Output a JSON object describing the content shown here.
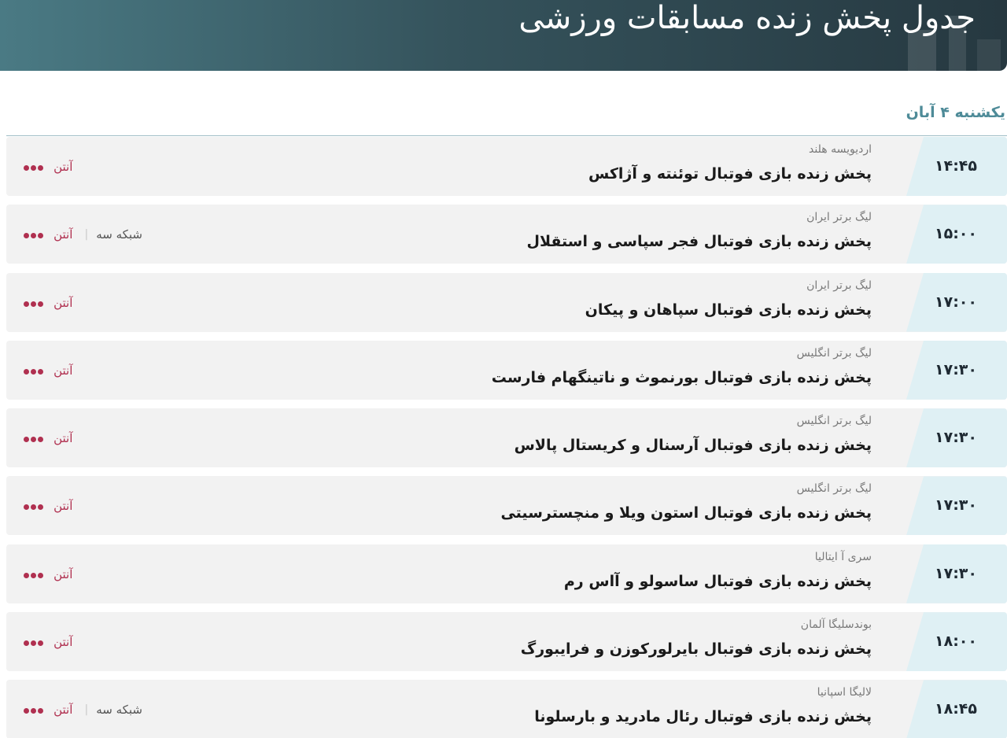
{
  "header": {
    "title": "جدول پخش زنده مسابقات ورزشی"
  },
  "day": {
    "label": "یکشنبه ۴ آبان"
  },
  "matches": [
    {
      "time": "۱۴:۴۵",
      "league": "اردیویسه هلند",
      "title": "پخش زنده بازی فوتبال توئنته و آژاکس",
      "antenna": "آنتن",
      "network": ""
    },
    {
      "time": "۱۵:۰۰",
      "league": "لیگ برتر ایران",
      "title": "پخش زنده بازی فوتبال فجر سپاسی و استقلال",
      "antenna": "آنتن",
      "network": "شبکه سه"
    },
    {
      "time": "۱۷:۰۰",
      "league": "لیگ برتر ایران",
      "title": "پخش زنده بازی فوتبال سپاهان و پیکان",
      "antenna": "آنتن",
      "network": ""
    },
    {
      "time": "۱۷:۳۰",
      "league": "لیگ برتر انگلیس",
      "title": "پخش زنده بازی فوتبال بورنموث و ناتینگهام فارست",
      "antenna": "آنتن",
      "network": ""
    },
    {
      "time": "۱۷:۳۰",
      "league": "لیگ برتر انگلیس",
      "title": "پخش زنده بازی فوتبال آرسنال و کریستال پالاس",
      "antenna": "آنتن",
      "network": ""
    },
    {
      "time": "۱۷:۳۰",
      "league": "لیگ برتر انگلیس",
      "title": "پخش زنده بازی فوتبال استون ویلا و منچسترسیتی",
      "antenna": "آنتن",
      "network": ""
    },
    {
      "time": "۱۷:۳۰",
      "league": "سری آ ایتالیا",
      "title": "پخش زنده بازی فوتبال ساسولو و آاس رم",
      "antenna": "آنتن",
      "network": ""
    },
    {
      "time": "۱۸:۰۰",
      "league": "بوندسلیگا آلمان",
      "title": "پخش زنده بازی فوتبال بایرلورکوزن و فرایبورگ",
      "antenna": "آنتن",
      "network": ""
    },
    {
      "time": "۱۸:۴۵",
      "league": "لالیگا اسپانیا",
      "title": "پخش زنده بازی فوتبال رئال مادرید و بارسلونا",
      "antenna": "آنتن",
      "network": "شبکه سه"
    }
  ],
  "icons": {
    "channel_dots": "more-dots-icon"
  },
  "colors": {
    "accent": "#4e8b98",
    "time_cell": "#dff0f4",
    "antenna": "#b03050"
  }
}
